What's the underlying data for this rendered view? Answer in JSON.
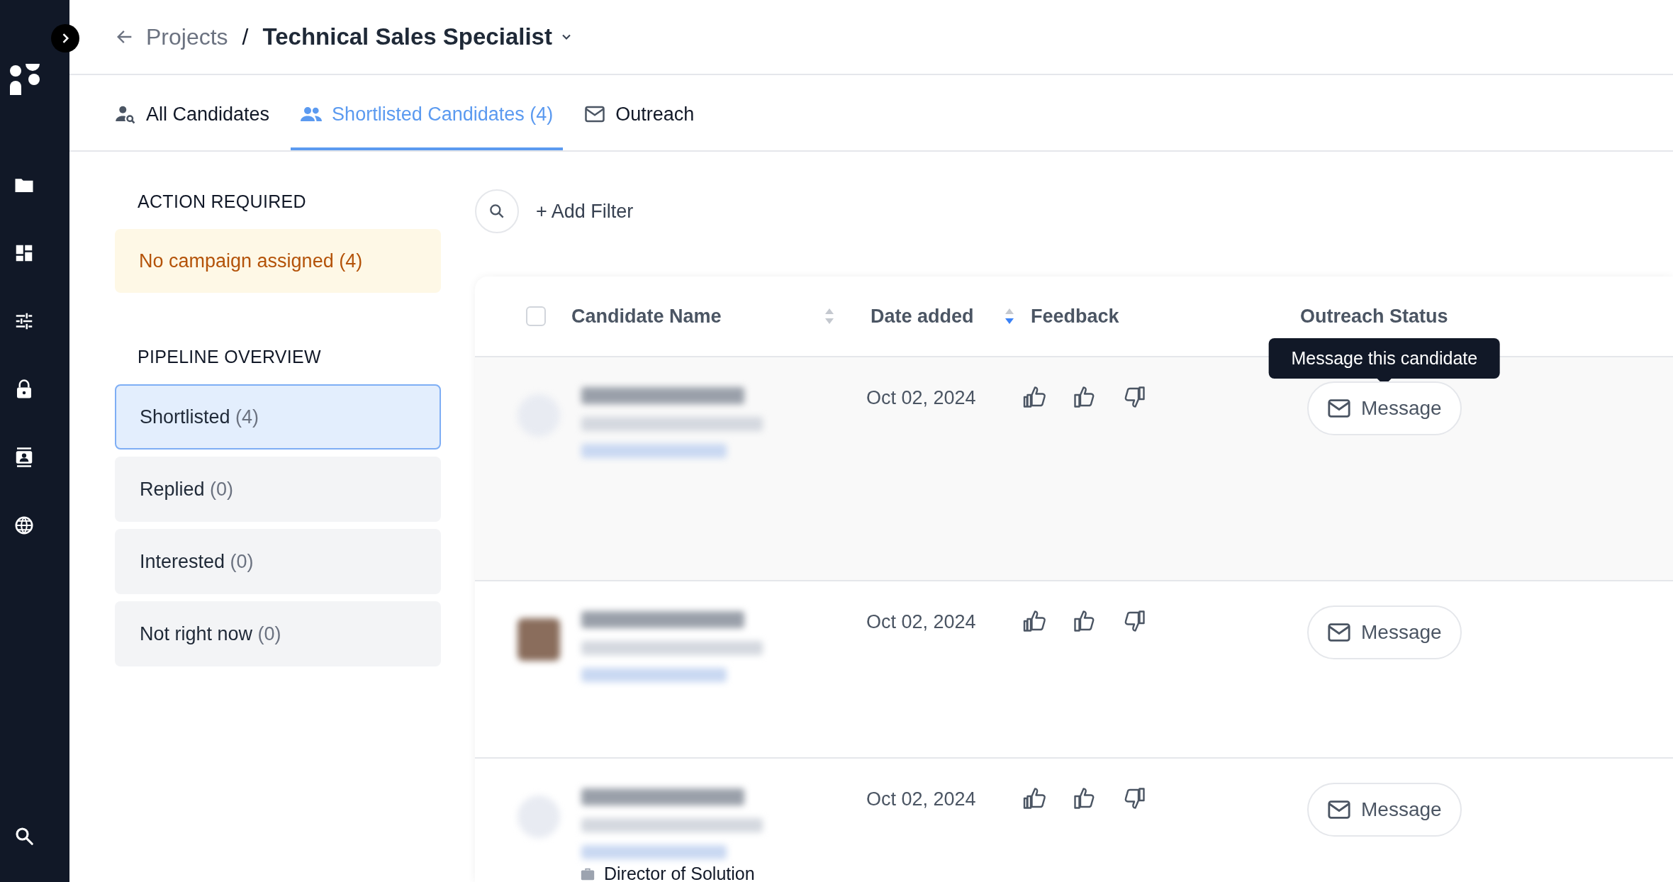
{
  "breadcrumb": {
    "parent": "Projects",
    "separator": "/",
    "current": "Technical Sales Specialist"
  },
  "tabs": [
    {
      "label": "All Candidates",
      "selected": false
    },
    {
      "label": "Shortlisted Candidates (4)",
      "selected": true
    },
    {
      "label": "Outreach",
      "selected": false
    }
  ],
  "action_required": {
    "heading": "ACTION REQUIRED",
    "alert": "No campaign assigned (4)"
  },
  "pipeline": {
    "heading": "PIPELINE OVERVIEW",
    "items": [
      {
        "label": "Shortlisted",
        "count": "(4)",
        "selected": true
      },
      {
        "label": "Replied",
        "count": "(0)",
        "selected": false
      },
      {
        "label": "Interested",
        "count": "(0)",
        "selected": false
      },
      {
        "label": "Not right now",
        "count": "(0)",
        "selected": false
      }
    ]
  },
  "toolbar": {
    "add_filter": "+ Add Filter"
  },
  "table": {
    "select_all": {
      "checked": false
    },
    "columns": [
      {
        "label": "Candidate Name",
        "sort_active": false
      },
      {
        "label": "Date added",
        "sort_active": true
      },
      {
        "label": "Feedback"
      },
      {
        "label": "Outreach Status"
      }
    ],
    "rows": [
      {
        "date": "Oct 02, 2024",
        "button": "Message",
        "hovered": true,
        "photo": false
      },
      {
        "date": "Oct 02, 2024",
        "button": "Message",
        "hovered": false,
        "photo": true
      },
      {
        "date": "Oct 02, 2024",
        "button": "Message",
        "hovered": false,
        "photo": false,
        "title": "Director of Solution"
      }
    ]
  },
  "tooltip": "Message this candidate"
}
